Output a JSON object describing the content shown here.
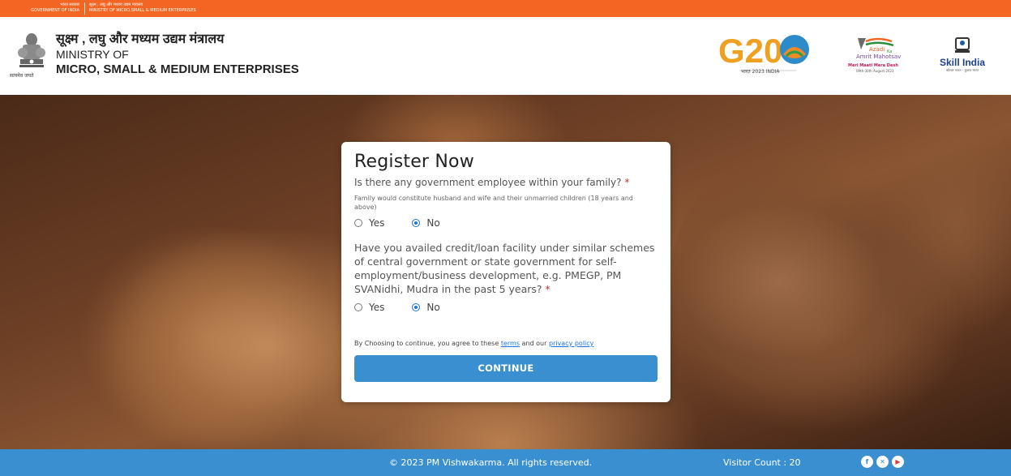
{
  "gov_bar": {
    "left_hindi": "भारत सरकार",
    "left_english": "GOVERNMENT OF INDIA",
    "right_hindi": "सूक्ष्म , लघु और मध्यम उद्यम मंत्रालय",
    "right_english": "MINISTRY OF MICRO,SMALL & MEDIUM ENTERPRISES"
  },
  "header": {
    "ministry_hindi": "सूक्ष्म , लघु और मध्यम उद्यम मंत्रालय",
    "ministry_line2": "MINISTRY OF",
    "ministry_line3": "MICRO, SMALL & MEDIUM ENTERPRISES",
    "emblem_caption": "सत्यमेव जयते",
    "g20_text": "G20",
    "g20_caption": "भारत 2023 INDIA",
    "azadi_line1": "Azadi",
    "azadi_line2": "Ka",
    "azadi_line3": "Amrit Mahotsav",
    "azadi_line4": "Meri Maati Mera Desh",
    "azadi_line5": "09th-30th August 2023",
    "skill_india": "Skill India",
    "skill_india_sub": "कौशल भारत - कुशल भारत"
  },
  "form": {
    "title": "Register Now",
    "q1": "Is there any government employee within your family?",
    "q1_required": "*",
    "q1_note": "Family would constitute husband and wife and their unmarried children (18 years and above)",
    "q1_options": [
      "Yes",
      "No"
    ],
    "q1_selected": "No",
    "q2": "Have you availed credit/loan facility under similar schemes of central government or state government for self-employment/business development, e.g. PMEGP, PM SVANidhi, Mudra in the past 5 years?",
    "q2_required": "*",
    "q2_options": [
      "Yes",
      "No"
    ],
    "q2_selected": "No",
    "consent_prefix": "By Choosing to continue, you agree to these",
    "consent_terms": "terms",
    "consent_mid": "and our",
    "consent_privacy": "privacy policy",
    "continue_label": "CONTINUE"
  },
  "footer": {
    "copyright": "© 2023 PM Vishwakarma. All rights reserved.",
    "visitor_count": "Visitor Count : 20",
    "social_icons": [
      "facebook-icon",
      "x-icon",
      "youtube-icon"
    ]
  },
  "colors": {
    "gov_bar": "#f26522",
    "primary": "#3a8fd0",
    "required": "#d32f2f"
  }
}
